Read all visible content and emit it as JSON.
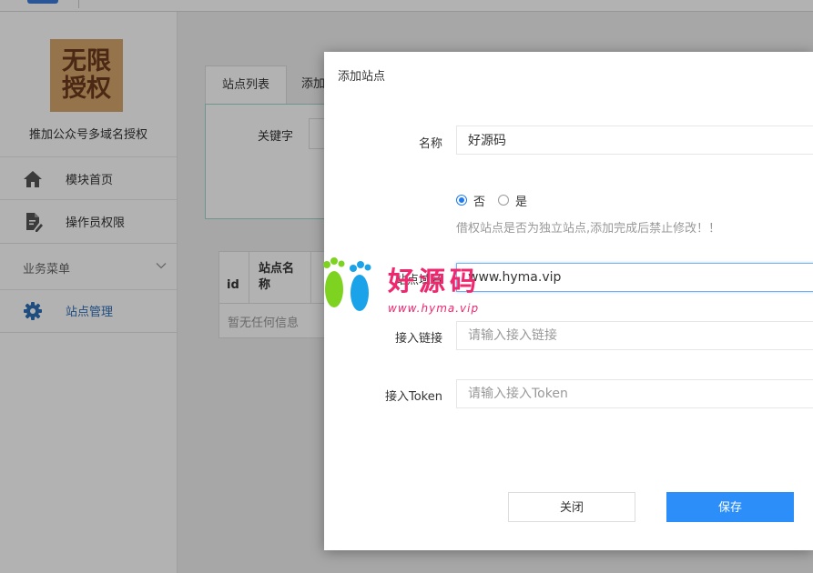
{
  "sidebar": {
    "brand_logo_text": [
      "无限",
      "授权"
    ],
    "brand_name": "推加公众号多域名授权",
    "items": [
      {
        "label": "模块首页",
        "icon": "home-icon"
      },
      {
        "label": "操作员权限",
        "icon": "document-edit-icon"
      }
    ],
    "group_label": "业务菜单",
    "group_items": [
      {
        "label": "站点管理",
        "icon": "gear-icon",
        "active": true
      }
    ]
  },
  "main": {
    "tabs": [
      {
        "label": "站点列表",
        "active": true
      },
      {
        "label": "添加",
        "active": false
      }
    ],
    "search": {
      "keyword_label": "关键字"
    },
    "table": {
      "columns": [
        "id",
        "站点名称"
      ],
      "empty_text": "暂无任何信息"
    }
  },
  "modal": {
    "title": "添加站点",
    "fields": {
      "name": {
        "label": "名称",
        "value": "好源码"
      },
      "borrow": {
        "options": [
          {
            "label": "否",
            "checked": true
          },
          {
            "label": "是",
            "checked": false
          }
        ],
        "hint": "借权站点是否为独立站点,添加完成后禁止修改！！"
      },
      "domain": {
        "label": "站点域名",
        "value": "www.hyma.vip"
      },
      "link": {
        "label": "接入链接",
        "value": "",
        "placeholder": "请输入接入链接"
      },
      "token": {
        "label": "接入Token",
        "value": "",
        "placeholder": "请输入接入Token"
      }
    },
    "buttons": {
      "close": "关闭",
      "save": "保存"
    }
  },
  "watermark": {
    "text": "好源码",
    "url": "www.hyma.vip"
  },
  "colors": {
    "primary": "#2c8ef8",
    "accent_nav": "#2f6fb7",
    "watermark": "#f0276e",
    "logo_bg": "#d6a56c"
  }
}
